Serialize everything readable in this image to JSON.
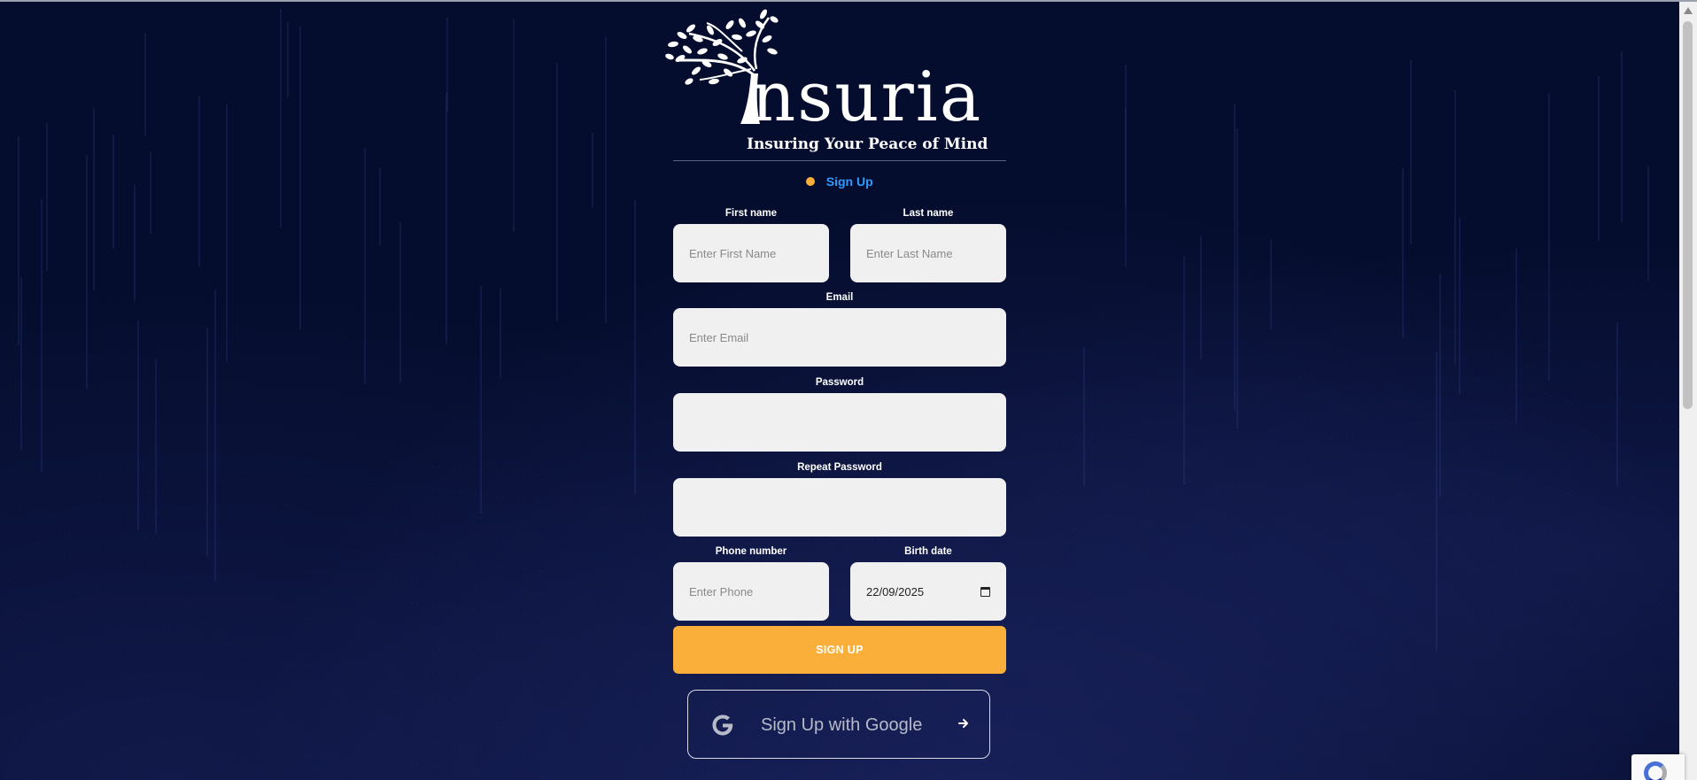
{
  "brand": {
    "name": "nsuria",
    "tagline": "Insuring Your Peace of Mind"
  },
  "tabs": {
    "active_label": "Sign Up"
  },
  "form": {
    "first_name": {
      "label": "First name",
      "placeholder": "Enter First Name",
      "value": ""
    },
    "last_name": {
      "label": "Last name",
      "placeholder": "Enter Last Name",
      "value": ""
    },
    "email": {
      "label": "Email",
      "placeholder": "Enter Email",
      "value": ""
    },
    "password": {
      "label": "Password",
      "placeholder": "",
      "value": ""
    },
    "repeat_password": {
      "label": "Repeat Password",
      "placeholder": "",
      "value": ""
    },
    "phone": {
      "label": "Phone number",
      "placeholder": "Enter Phone",
      "value": ""
    },
    "birth_date": {
      "label": "Birth date",
      "value": "22/09/2025"
    }
  },
  "buttons": {
    "signup_label": "SIGN UP",
    "google_label": "Sign Up with Google"
  },
  "icons": {
    "google": "google-icon",
    "arrow": "arrow-right-icon",
    "calendar": "calendar-icon",
    "status_dot": "active-dot-icon"
  },
  "colors": {
    "background": "#050d2e",
    "accent": "#fbaf3b",
    "tab_text": "#2f9bff",
    "input_bg": "#f0f0f0"
  }
}
